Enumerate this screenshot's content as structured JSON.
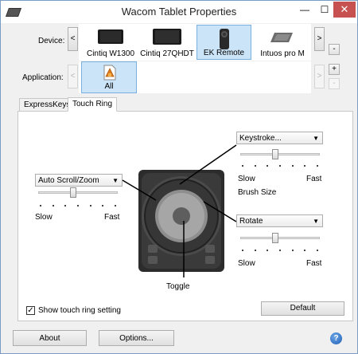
{
  "window": {
    "title": "Wacom Tablet Properties",
    "min": "—",
    "max": "☐",
    "close": "✕"
  },
  "device_row": {
    "label": "Device:",
    "prev": "<",
    "next": ">",
    "remove": "-",
    "items": [
      {
        "label": "Cintiq W1300",
        "icon": "display-tablet-icon",
        "selected": false
      },
      {
        "label": "Cintiq 27QHDT",
        "icon": "display-tablet-icon",
        "selected": false
      },
      {
        "label": "EK Remote",
        "icon": "remote-icon",
        "selected": true
      },
      {
        "label": "Intuos pro M",
        "icon": "pen-tablet-icon",
        "selected": false
      }
    ]
  },
  "application_row": {
    "label": "Application:",
    "prev": "<",
    "next": ">",
    "add": "+",
    "remove": "-",
    "items": [
      {
        "label": "All",
        "icon": "all-apps-icon",
        "selected": true
      }
    ]
  },
  "tabs": [
    {
      "label": "ExpressKeys",
      "active": false
    },
    {
      "label": "Touch Ring",
      "active": true
    }
  ],
  "touch_ring": {
    "left": {
      "mode": "Auto Scroll/Zoom",
      "slow": "Slow",
      "fast": "Fast",
      "level": 0.43
    },
    "top_right": {
      "mode": "Keystroke...",
      "slow": "Slow",
      "fast": "Fast",
      "subtitle": "Brush Size",
      "level": 0.43
    },
    "bottom_right": {
      "mode": "Rotate",
      "slow": "Slow",
      "fast": "Fast",
      "level": 0.43
    },
    "toggle_label": "Toggle",
    "show_setting_label": "Show touch ring setting",
    "show_setting_checked": true,
    "default_button": "Default"
  },
  "footer": {
    "about_button": "About",
    "options_button": "Options...",
    "help": "?"
  }
}
